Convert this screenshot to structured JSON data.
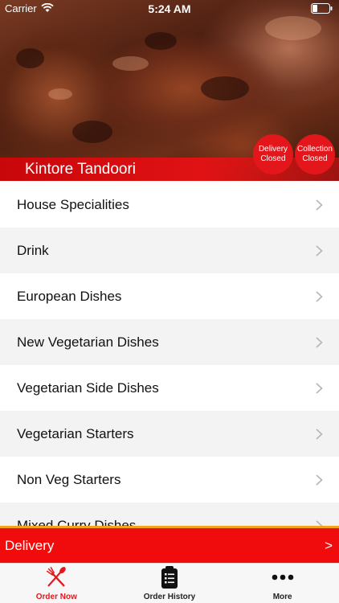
{
  "status_bar": {
    "carrier": "Carrier",
    "time": "5:24 AM"
  },
  "header": {
    "restaurant_name": "Kintore Tandoori",
    "delivery_status": "Delivery\nClosed",
    "collection_status": "Collection\nClosed"
  },
  "menu": {
    "categories": [
      "House Specialities",
      "Drink",
      "European Dishes",
      "New Vegetarian Dishes",
      "Vegetarian Side Dishes",
      "Vegetarian Starters",
      "Non Veg Starters",
      "Mixed Curry Dishes"
    ]
  },
  "order_mode": {
    "label": "Delivery",
    "arrow": ">"
  },
  "tabs": [
    {
      "label": "Order Now",
      "icon": "fork-knife-icon",
      "active": true
    },
    {
      "label": "Order History",
      "icon": "clipboard-list-icon",
      "active": false
    },
    {
      "label": "More",
      "icon": "more-dots-icon",
      "active": false
    }
  ],
  "colors": {
    "accent": "#e3171b",
    "delivery_bar": "#f00c0c",
    "divider": "#f3a31b"
  }
}
